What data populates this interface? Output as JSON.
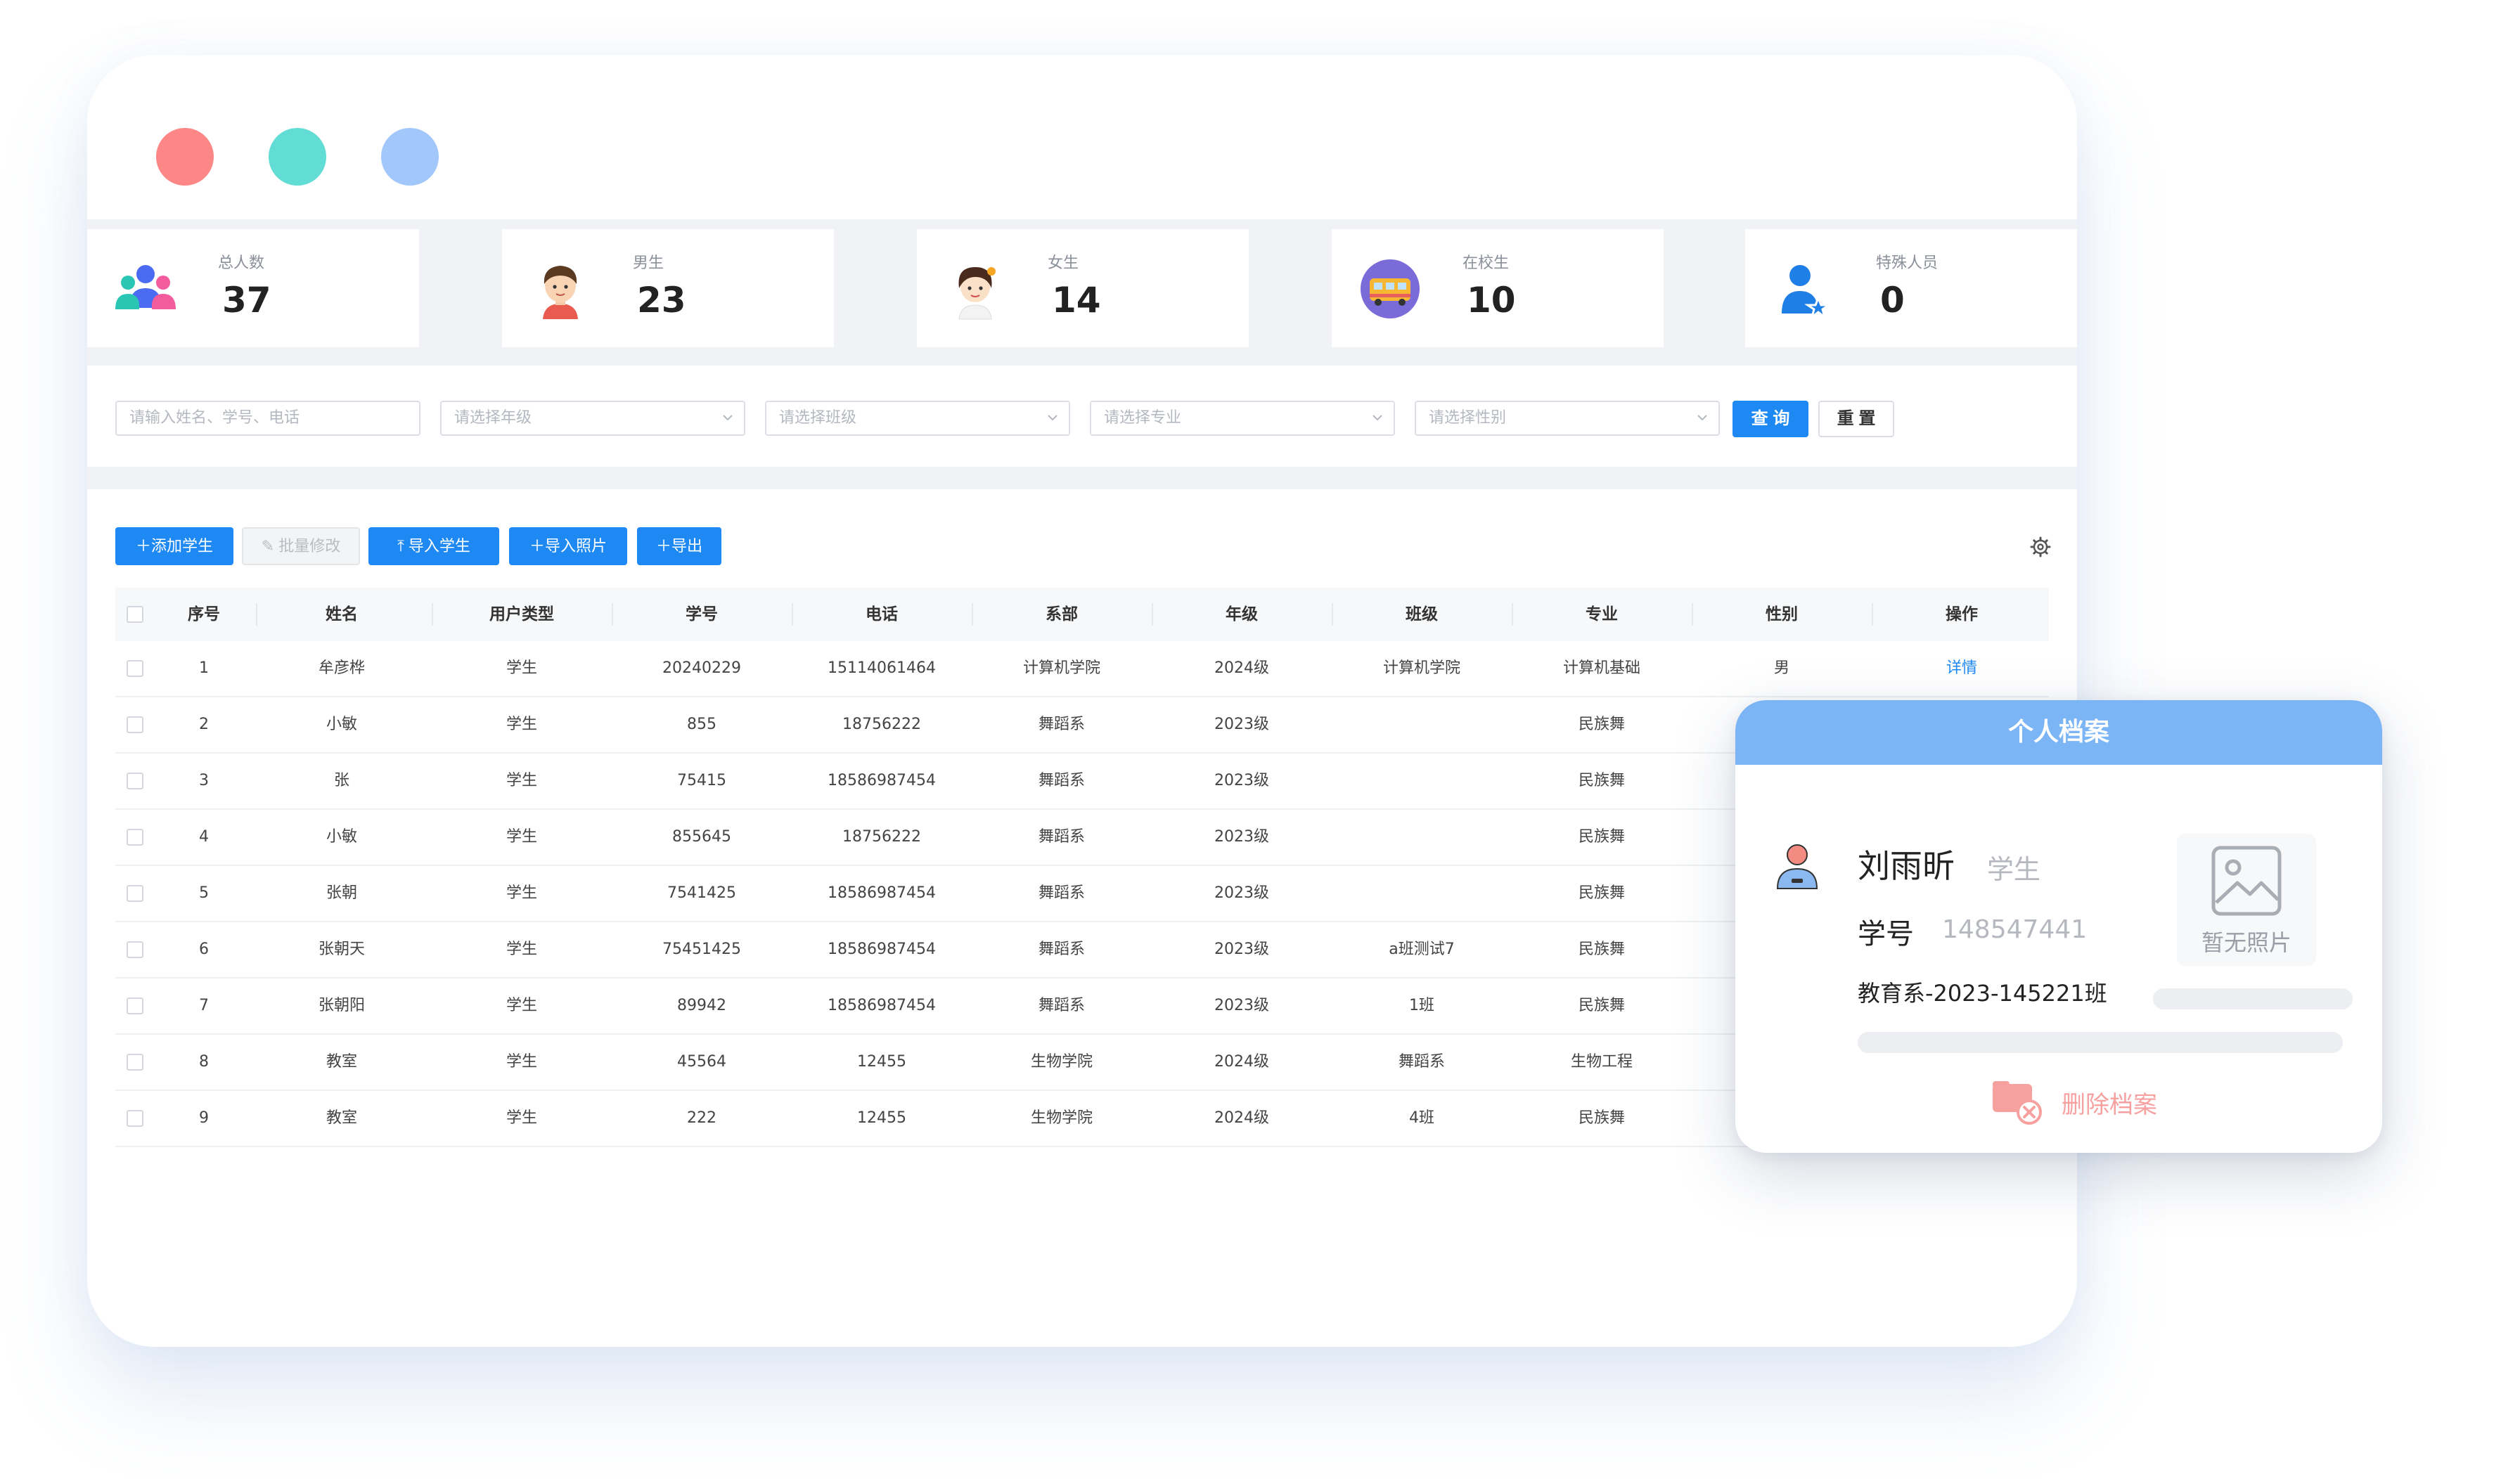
{
  "colors": {
    "accent": "#1e89f2",
    "window_dot_red": "#fd8686",
    "window_dot_green": "#61ddd5",
    "window_dot_blue": "#a2c8fb",
    "card_header": "#7bb5f6",
    "delete": "#f7a0a0"
  },
  "stats": [
    {
      "label": "总人数",
      "value": "37",
      "icon": "group-users-icon"
    },
    {
      "label": "男生",
      "value": "23",
      "icon": "male-student-avatar-icon"
    },
    {
      "label": "女生",
      "value": "14",
      "icon": "female-student-avatar-icon"
    },
    {
      "label": "在校生",
      "value": "10",
      "icon": "school-bus-icon"
    },
    {
      "label": "特殊人员",
      "value": "0",
      "icon": "special-person-icon"
    }
  ],
  "filters": {
    "search_placeholder": "请输入姓名、学号、电话",
    "grade_placeholder": "请选择年级",
    "class_placeholder": "请选择班级",
    "major_placeholder": "请选择专业",
    "gender_placeholder": "请选择性别",
    "query_label": "查 询",
    "reset_label": "重 置"
  },
  "actions": {
    "add_student": "添加学生",
    "batch_edit": "批量修改",
    "import_students": "导入学生",
    "import_photos": "导入照片",
    "export": "导出"
  },
  "table": {
    "columns": [
      "序号",
      "姓名",
      "用户类型",
      "学号",
      "电话",
      "系部",
      "年级",
      "班级",
      "专业",
      "性别",
      "操作"
    ],
    "rows": [
      [
        "1",
        "牟彦桦",
        "学生",
        "20240229",
        "15114061464",
        "计算机学院",
        "2024级",
        "计算机学院",
        "计算机基础",
        "男",
        "详情"
      ],
      [
        "2",
        "小敏",
        "学生",
        "855",
        "18756222",
        "舞蹈系",
        "2023级",
        "",
        "民族舞",
        "",
        ""
      ],
      [
        "3",
        "张",
        "学生",
        "75415",
        "18586987454",
        "舞蹈系",
        "2023级",
        "",
        "民族舞",
        "",
        ""
      ],
      [
        "4",
        "小敏",
        "学生",
        "855645",
        "18756222",
        "舞蹈系",
        "2023级",
        "",
        "民族舞",
        "",
        ""
      ],
      [
        "5",
        "张朝",
        "学生",
        "7541425",
        "18586987454",
        "舞蹈系",
        "2023级",
        "",
        "民族舞",
        "",
        ""
      ],
      [
        "6",
        "张朝天",
        "学生",
        "75451425",
        "18586987454",
        "舞蹈系",
        "2023级",
        "a班测试7",
        "民族舞",
        "",
        ""
      ],
      [
        "7",
        "张朝阳",
        "学生",
        "89942",
        "18586987454",
        "舞蹈系",
        "2023级",
        "1班",
        "民族舞",
        "",
        ""
      ],
      [
        "8",
        "教室",
        "学生",
        "45564",
        "12455",
        "生物学院",
        "2024级",
        "舞蹈系",
        "生物工程",
        "",
        ""
      ],
      [
        "9",
        "教室",
        "学生",
        "222",
        "12455",
        "生物学院",
        "2024级",
        "4班",
        "民族舞",
        "",
        ""
      ]
    ]
  },
  "profile_card": {
    "title": "个人档案",
    "name": "刘雨昕",
    "role": "学生",
    "id_label": "学号",
    "id_value": "148547441",
    "class_info": "教育系-2023-145221班",
    "no_photo": "暂无照片",
    "delete_label": "删除档案"
  }
}
